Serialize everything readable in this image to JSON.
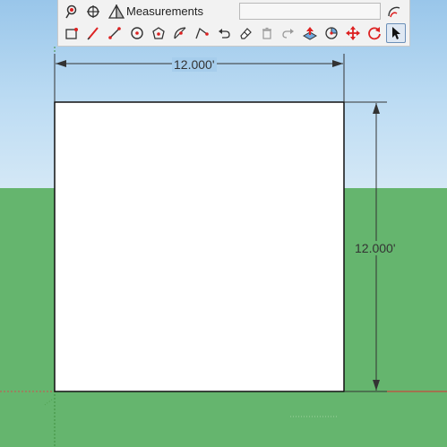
{
  "toolbar": {
    "measurements_label": "Measurements",
    "measurements_value": "",
    "row1_icons": [
      "position-camera-icon",
      "orbit-icon",
      "section-plane-icon",
      "freehand-icon"
    ],
    "row2_icons": [
      "rectangle-icon",
      "line-pencil-icon",
      "line-icon",
      "circle-icon",
      "polygon-icon",
      "arc-icon",
      "protractor-icon",
      "undo-icon",
      "eraser-icon",
      "delete-icon",
      "redo-icon",
      "push-pull-icon",
      "rotate-icon",
      "move-icon",
      "orbit-refresh-icon",
      "select-arrow-icon"
    ],
    "selected_tool": "select-arrow-icon"
  },
  "dimensions": {
    "width_label": "12.000'",
    "height_label": "12.000'"
  },
  "colors": {
    "sky_top": "#99c6ea",
    "ground": "#65b56e",
    "face": "#ffffff",
    "edge": "#111111",
    "dimension": "#333333",
    "axis_red": "#e03030"
  }
}
